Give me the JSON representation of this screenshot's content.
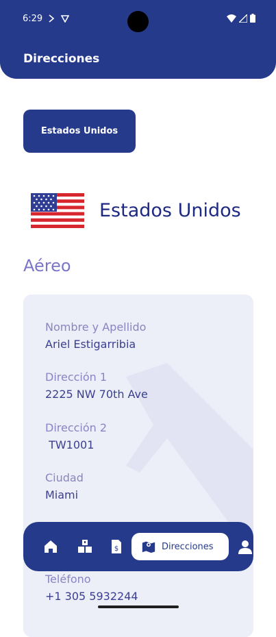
{
  "status_bar": {
    "time": "6:29"
  },
  "header": {
    "title": "Direcciones"
  },
  "country_selector": {
    "label": "Estados Unidos"
  },
  "country": {
    "name": "Estados Unidos"
  },
  "section": {
    "title": "Aéreo"
  },
  "address": {
    "fields": [
      {
        "label": "Nombre y Apellido",
        "value": "Ariel Estigarribia"
      },
      {
        "label": "Dirección 1",
        "value": "2225 NW 70th Ave"
      },
      {
        "label": "Dirección 2",
        "value": " TW1001"
      },
      {
        "label": "Ciudad",
        "value": "Miami"
      },
      {
        "label": "Teléfono",
        "value": "+1 305 5932244"
      }
    ]
  },
  "bottom_nav": {
    "items": [
      {
        "icon": "home-icon"
      },
      {
        "icon": "boxes-icon"
      },
      {
        "icon": "invoice-icon"
      },
      {
        "icon": "map-icon",
        "label": "Direcciones",
        "active": true
      },
      {
        "icon": "user-icon"
      }
    ]
  },
  "colors": {
    "primary": "#263a8c",
    "heading": "#1e2a82",
    "section": "#7b75c9",
    "card_bg": "#eceef8",
    "label": "#8a84c2",
    "value": "#3a3f8f"
  }
}
